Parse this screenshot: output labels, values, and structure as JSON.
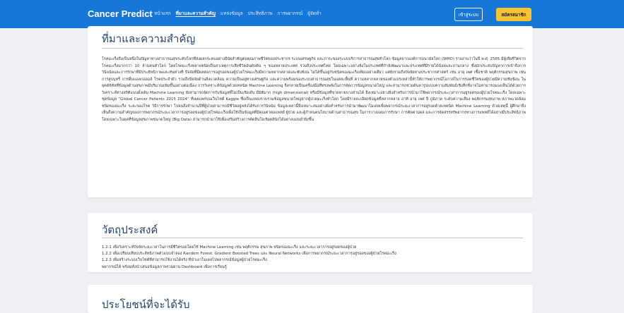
{
  "navbar": {
    "brand": "Cancer Predict",
    "links": [
      {
        "label": "หน้าแรก",
        "active": false
      },
      {
        "label": "ที่มาและความสำคัญ",
        "active": true
      },
      {
        "label": "แหล่งข้อมูล",
        "active": false
      },
      {
        "label": "ประสิทธิภาพ",
        "active": false
      },
      {
        "label": "การพยากรณ์",
        "active": false
      },
      {
        "label": "ผู้จัดทำ",
        "active": false
      }
    ],
    "login_label": "เข้าสู่ระบบ",
    "register_label": "สมัครสมาชิก",
    "bg_color": "#1677d8",
    "register_color": "#f7c331"
  },
  "section_background": {
    "title": "ที่มาและความสำคัญ",
    "body": "โรคมะเร็งถือเป็นหนึ่งในปัญหาทางสาธารณสุขระดับโลกที่ส่งผลกระทบอย่างมีนัยสำคัญต่อคุณภาพชีวิตของประชากร ระบบเศรษฐกิจ และภาระของระบบบริการสาธารณสุขทั่วโลก ข้อมูลจากองค์การอนามัยโลก (WHO) รายงานว่าในปี พ.ศ. 2565 มีผู้เสียชีวิตจากโรคมะเร็งมากกว่า 10 ล้านคนทั่วโลก โดยโรคมะเร็งหลายชนิดเป็นสาเหตุการเสียชีวิตอันดับต้น ๆ ของหลายประเทศ รวมถึงประเทศไทย โดยเฉพาะอย่างยิ่งในประเทศที่กำลังพัฒนาและประเทศที่มีรายได้น้อยและปานกลาง ซึ่งมักประสบปัญหาการเข้าถึงการวินิจฉัยและการรักษาที่มีประสิทธิภาพและทันท่วงที ปัจจัยที่มีผลต่อการอยู่รอดของผู้ป่วยโรคมะเร็งมีความหลากหลายและซับซ้อน ไม่ได้ขึ้นอยู่กับชนิดของมะเร็งเพียงอย่างเดียว แต่ยังรวมถึงปัจจัยทางประชากรศาสตร์ เช่น อายุ เพศ เชื้อชาติ พฤติกรรมสุขภาพ เช่น การสูบบุหรี่ การดื่มแอลกอฮอล์ โรคประจำตัว รวมถึงปัจจัยด้านสิ่งแวดล้อม ความเป็นอยู่ทางเศรษฐกิจ และความพร้อมของระบบสาธารณสุขในแต่ละพื้นที่ ความหลากหลายของตัวแปรเหล่านี้ทำให้การพยากรณ์โอกาสในการรอดชีวิตของผู้ป่วยมีความซับซ้อน ในยุคดิจิทัลที่ข้อมูลด้านสุขภาพมีปริมาณเพิ่มขึ้นอย่างต่อเนื่อง การวิเคราะห์ข้อมูลด้วยเทคนิค Machine Learning จึงกลายเป็นเครื่องมือที่ทรงพลังในการจัดการข้อมูลขนาดใหญ่ และสามารถช่วยค้นหารูปแบบความสัมพันธ์เชิงลึกที่อาจไม่สามารถมองเห็นได้ด้วยการวิเคราะห์ทางสถิติแบบดั้งเดิม Machine Learning ยังสามารถจัดการกับข้อมูลที่ไม่เป็นเชิงเส้น มีมิติมาก (high dimensional) หรือมีข้อมูลที่ขาดหายบางส่วนได้ จึงเหมาะอย่างยิ่งสำหรับการนำมาใช้พยากรณ์ระยะเวลาการอยู่รอดของผู้ป่วยโรคมะเร็ง โดยเฉพาะชุดข้อมูล “Global Cancer Patients 2015 2024” ที่เผยแพร่บนเว็บไซต์ Kaggle ซึ่งเป็นแหล่งรวบรวมข้อมูลขนาดใหญ่จากผู้ป่วยมะเร็งทั่วโลก โดยมีรายละเอียดข้อมูลที่หลากหลาย อาทิ อายุ เพศ ปี ภูมิภาค ระดับความเสี่ยง พฤติกรรมสุขภาพ สภาพแวดล้อม ชนิดของมะเร็ง ระยะของโรค วิธีการรักษา ไปจนถึงจำนวนปีที่ผู้ป่วยสามารถมีชีวิตอยู่หลังได้รับการวินิจฉัย ข้อมูลเหล่านี้จึงเหมาะสมอย่างยิ่งสำหรับการนำมาพัฒนาโมเดลเพื่อพยากรณ์ระยะเวลาการอยู่รอดด้วยเทคนิค Machine Learning ด้วยเหตุนี้ ผู้ศึกษาจึงเห็นถึงความสำคัญของการพยากรณ์ระยะเวลาการอยู่รอดของผู้ป่วยโรคมะเร็งเพื่อใช้เป็นข้อมูลที่มีคุณค่าต่อแพทย์ ผู้ป่วย และผู้กำหนดนโยบายด้านสาธารณสุข ในการวางแผนการรักษา การติดตามผล และการจัดสรรทรัพยากรทางการแพทย์ได้อย่างมีประสิทธิภาพ โดยเฉพาะในยุคที่ข้อมูลสุขภาพขนาดใหญ่ (Big Data) สามารถนำมาใช้เพื่อเสริมสร้างการตัดสินใจเชิงคลินิกได้อย่างแม่นยำยิ่งขึ้น"
  },
  "section_objectives": {
    "title": "วัตถุประสงค์",
    "items": [
      "1.2.1 เพื่อวิเคราะห์ปัจจัยระยะเวลาในการมีชีวิตรอดโดยใช้ Machine Learning เช่น พฤติกรรม สุขภาพ ชนิดของมะเร็ง และระยะเวลาการอยู่รอดของผู้ป่วย",
      "1.2.2 เพื่อเปรียบเทียบประสิทธิภาพตัวแบบจำลอง Random Forest, Gradient Boosted Trees และ Neural Networks เพื่อการพยากรณ์ระยะเวลาการอยู่รอดของผู้ป่วยโรคมะเร็ง",
      "1.2.3 เพื่อสร้างระบบเว็บไซต์ที่สามารถใช้งานได้จริง ที่นำเอาโมเดลไปพยากรณ์ข้อมูลผู้ป่วยโรคมะเร็ง",
      "พยากรณ์ได้ พร้อมทั้งนำเสนอข้อมูลภาพรวมผ่าน Dashboard เพื่อการเรียนรู้"
    ]
  },
  "section_benefits": {
    "title": "ประโยชน์ที่จะได้รับ"
  }
}
